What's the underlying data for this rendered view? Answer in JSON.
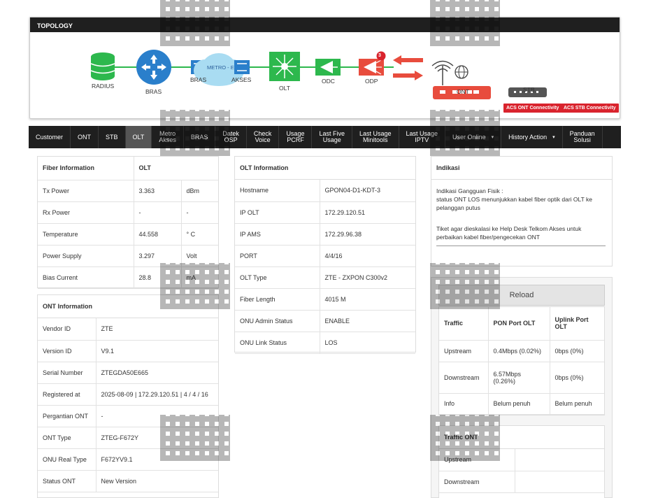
{
  "topology": {
    "title": "TOPOLOGY",
    "nodes": {
      "radius": "RADIUS",
      "bras": "BRAS",
      "bras_small": "BRAS",
      "metro": "METRO - E",
      "akses": "AKSES",
      "olt": "OLT",
      "odc": "ODC",
      "odp": "ODP",
      "ont": "ONT",
      "stb": "STB"
    },
    "odp_badge": "3",
    "acs_ont": "ACS ONT Connectivity",
    "acs_stb": "ACS STB Connectivity",
    "colors": {
      "green": "#2db84d",
      "blue": "#2a7fcb",
      "red": "#e84c3d",
      "cloud": "#a9dcf2",
      "dark": "#1f1f1f"
    }
  },
  "nav": [
    {
      "l1": "Customer",
      "l2": ""
    },
    {
      "l1": "ONT",
      "l2": ""
    },
    {
      "l1": "STB",
      "l2": ""
    },
    {
      "l1": "OLT",
      "l2": "",
      "active": true
    },
    {
      "l1": "Metro",
      "l2": "Akses"
    },
    {
      "l1": "BRAS",
      "l2": ""
    },
    {
      "l1": "Datek",
      "l2": "OSP"
    },
    {
      "l1": "Check",
      "l2": "Voice"
    },
    {
      "l1": "Usage",
      "l2": "PCRF"
    },
    {
      "l1": "Last Five",
      "l2": "Usage"
    },
    {
      "l1": "Last Usage",
      "l2": "Minitools"
    },
    {
      "l1": "Last Usage",
      "l2": "IPTV"
    },
    {
      "l1": "User Online",
      "l2": "",
      "caret": "▾"
    },
    {
      "l1": "History Action",
      "l2": "",
      "caret": "▾"
    },
    {
      "l1": "Panduan",
      "l2": "Solusi"
    }
  ],
  "fiber": {
    "title": "Fiber Information",
    "col": "OLT",
    "rows": [
      {
        "k": "Tx Power",
        "v": "3.363",
        "u": "dBm"
      },
      {
        "k": "Rx Power",
        "v": "-",
        "u": "-"
      },
      {
        "k": "Temperature",
        "v": "44.558",
        "u": "° C"
      },
      {
        "k": "Power Supply",
        "v": "3.297",
        "u": "Volt"
      },
      {
        "k": "Bias Current",
        "v": "28.8",
        "u": "mA"
      }
    ]
  },
  "ont_info": {
    "title": "ONT Information",
    "rows": [
      {
        "k": "Vendor ID",
        "v": "ZTE"
      },
      {
        "k": "Version ID",
        "v": "V9.1"
      },
      {
        "k": "Serial Number",
        "v": "ZTEGDA50E665"
      },
      {
        "k": "Registered at",
        "v": "2025-08-09 | 172.29.120.51 | 4 / 4 / 16"
      },
      {
        "k": "Pergantian ONT",
        "v": "-"
      },
      {
        "k": "ONT Type",
        "v": "ZTEG-F672Y"
      },
      {
        "k": "ONU Real Type",
        "v": "F672YV9.1"
      },
      {
        "k": "Status ONT",
        "v": "New Version"
      }
    ]
  },
  "olt_info": {
    "title": "OLT Information",
    "rows": [
      {
        "k": "Hostname",
        "v": "GPON04-D1-KDT-3"
      },
      {
        "k": "IP OLT",
        "v": "172.29.120.51"
      },
      {
        "k": "IP AMS",
        "v": "172.29.96.38"
      },
      {
        "k": "PORT",
        "v": "4/4/16"
      },
      {
        "k": "OLT Type",
        "v": "ZTE - ZXPON C300v2"
      },
      {
        "k": "Fiber Length",
        "v": "4015 M"
      },
      {
        "k": "ONU Admin Status",
        "v": "ENABLE"
      },
      {
        "k": "ONU Link Status",
        "v": "LOS"
      }
    ]
  },
  "indikasi": {
    "title": "Indikasi",
    "line1": "Indikasi Gangguan Fisik :",
    "line2": "status ONT LOS menunjukkan kabel fiber optik dari OLT ke pelanggan putus",
    "line3": "Tiket agar dieskalasi ke Help Desk Telkom Akses untuk perbaikan kabel fiber/pengecekan ONT"
  },
  "traffic": {
    "reload": "Reload",
    "h_traffic": "Traffic",
    "h_pon": "PON Port OLT",
    "h_uplink": "Uplink Port OLT",
    "rows": [
      {
        "k": "Upstream",
        "pon": "0.4Mbps (0.02%)",
        "up": "0bps (0%)"
      },
      {
        "k": "Downstream",
        "pon": "6.57Mbps (0.26%)",
        "up": "0bps (0%)"
      },
      {
        "k": "Info",
        "pon": "Belum penuh",
        "up": "Belum penuh"
      }
    ]
  },
  "traffic_ont": {
    "title": "Traffic ONT",
    "rows": [
      {
        "k": "Upstream"
      },
      {
        "k": "Downstream"
      }
    ]
  }
}
